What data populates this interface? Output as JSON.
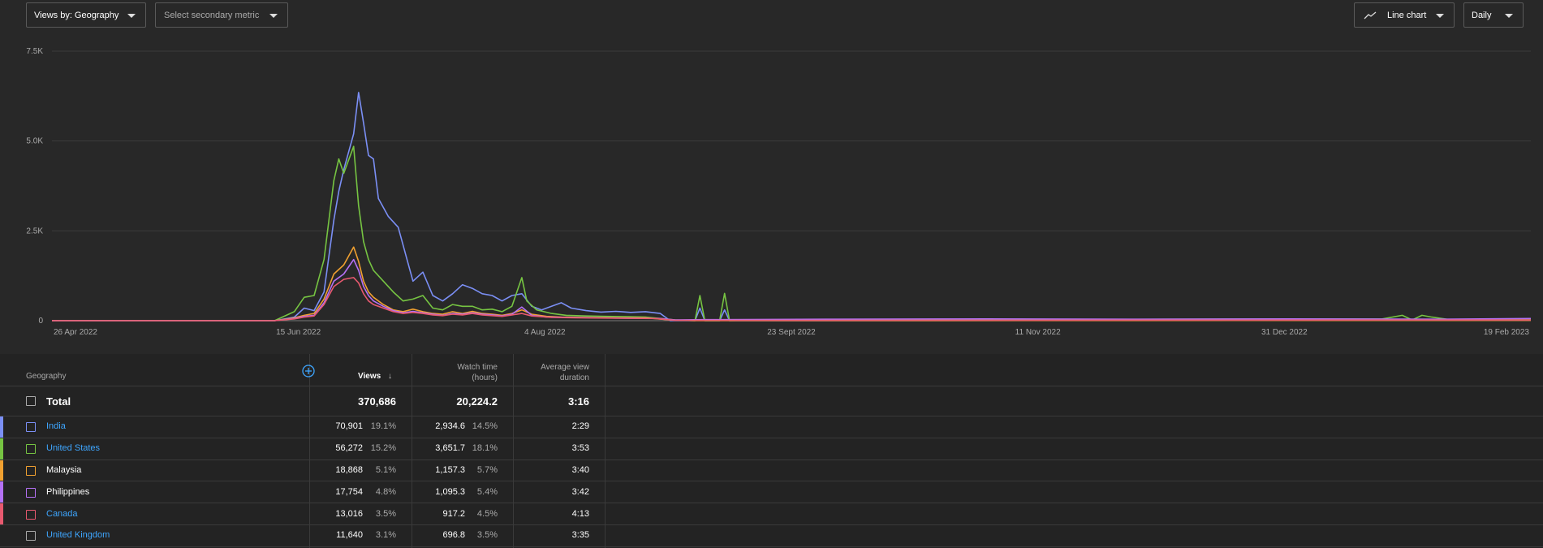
{
  "toolbar": {
    "primary_metric": "Views by: Geography",
    "secondary_metric_placeholder": "Select secondary metric",
    "chart_type": "Line chart",
    "granularity": "Daily"
  },
  "chart_data": {
    "type": "line",
    "xlabels": [
      "26 Apr 2022",
      "15 Jun 2022",
      "4 Aug 2022",
      "23 Sept 2022",
      "11 Nov 2022",
      "31 Dec 2022",
      "19 Feb 2023"
    ],
    "yticks": [
      "0",
      "2.5K",
      "5.0K",
      "7.5K"
    ],
    "ylim": [
      0,
      7500
    ],
    "x_start": "2022-04-26",
    "x_end": "2023-02-19",
    "grid": true,
    "series": [
      {
        "name": "India",
        "color": "#7b8ff5",
        "points": [
          [
            "2022-04-26",
            0
          ],
          [
            "2022-06-10",
            0
          ],
          [
            "2022-06-14",
            100
          ],
          [
            "2022-06-16",
            350
          ],
          [
            "2022-06-18",
            280
          ],
          [
            "2022-06-20",
            800
          ],
          [
            "2022-06-22",
            2800
          ],
          [
            "2022-06-23",
            3600
          ],
          [
            "2022-06-24",
            4200
          ],
          [
            "2022-06-26",
            5200
          ],
          [
            "2022-06-27",
            6350
          ],
          [
            "2022-06-28",
            5500
          ],
          [
            "2022-06-29",
            4600
          ],
          [
            "2022-06-30",
            4500
          ],
          [
            "2022-07-01",
            3400
          ],
          [
            "2022-07-03",
            2900
          ],
          [
            "2022-07-05",
            2600
          ],
          [
            "2022-07-07",
            1600
          ],
          [
            "2022-07-08",
            1100
          ],
          [
            "2022-07-10",
            1350
          ],
          [
            "2022-07-12",
            700
          ],
          [
            "2022-07-14",
            550
          ],
          [
            "2022-07-16",
            750
          ],
          [
            "2022-07-18",
            1000
          ],
          [
            "2022-07-20",
            900
          ],
          [
            "2022-07-22",
            750
          ],
          [
            "2022-07-24",
            700
          ],
          [
            "2022-07-26",
            550
          ],
          [
            "2022-07-28",
            700
          ],
          [
            "2022-07-30",
            750
          ],
          [
            "2022-08-01",
            400
          ],
          [
            "2022-08-03",
            300
          ],
          [
            "2022-08-05",
            400
          ],
          [
            "2022-08-07",
            500
          ],
          [
            "2022-08-09",
            350
          ],
          [
            "2022-08-12",
            280
          ],
          [
            "2022-08-15",
            240
          ],
          [
            "2022-08-18",
            260
          ],
          [
            "2022-08-21",
            230
          ],
          [
            "2022-08-24",
            250
          ],
          [
            "2022-08-27",
            200
          ],
          [
            "2022-08-29",
            0
          ],
          [
            "2022-09-03",
            0
          ],
          [
            "2022-09-04",
            350
          ],
          [
            "2022-09-05",
            0
          ],
          [
            "2022-09-08",
            0
          ],
          [
            "2022-09-09",
            300
          ],
          [
            "2022-09-10",
            0
          ],
          [
            "2022-09-15",
            0
          ],
          [
            "2023-02-19",
            20
          ]
        ]
      },
      {
        "name": "United States",
        "color": "#76c442",
        "points": [
          [
            "2022-04-26",
            0
          ],
          [
            "2022-06-10",
            0
          ],
          [
            "2022-06-14",
            250
          ],
          [
            "2022-06-16",
            650
          ],
          [
            "2022-06-18",
            700
          ],
          [
            "2022-06-20",
            1700
          ],
          [
            "2022-06-22",
            3900
          ],
          [
            "2022-06-23",
            4500
          ],
          [
            "2022-06-24",
            4100
          ],
          [
            "2022-06-26",
            4850
          ],
          [
            "2022-06-27",
            3200
          ],
          [
            "2022-06-28",
            2200
          ],
          [
            "2022-06-29",
            1700
          ],
          [
            "2022-06-30",
            1400
          ],
          [
            "2022-07-02",
            1100
          ],
          [
            "2022-07-04",
            800
          ],
          [
            "2022-07-06",
            550
          ],
          [
            "2022-07-08",
            600
          ],
          [
            "2022-07-10",
            700
          ],
          [
            "2022-07-12",
            350
          ],
          [
            "2022-07-14",
            300
          ],
          [
            "2022-07-16",
            450
          ],
          [
            "2022-07-18",
            400
          ],
          [
            "2022-07-20",
            400
          ],
          [
            "2022-07-22",
            300
          ],
          [
            "2022-07-24",
            320
          ],
          [
            "2022-07-26",
            250
          ],
          [
            "2022-07-28",
            400
          ],
          [
            "2022-07-30",
            1200
          ],
          [
            "2022-07-31",
            550
          ],
          [
            "2022-08-02",
            300
          ],
          [
            "2022-08-05",
            200
          ],
          [
            "2022-08-08",
            150
          ],
          [
            "2022-08-12",
            130
          ],
          [
            "2022-08-16",
            120
          ],
          [
            "2022-08-20",
            110
          ],
          [
            "2022-08-24",
            100
          ],
          [
            "2022-08-27",
            60
          ],
          [
            "2022-08-30",
            20
          ],
          [
            "2022-09-03",
            0
          ],
          [
            "2022-09-04",
            700
          ],
          [
            "2022-09-05",
            0
          ],
          [
            "2022-09-08",
            0
          ],
          [
            "2022-09-09",
            760
          ],
          [
            "2022-09-10",
            0
          ],
          [
            "2022-09-15",
            20
          ],
          [
            "2023-01-20",
            50
          ],
          [
            "2023-01-24",
            150
          ],
          [
            "2023-01-26",
            20
          ],
          [
            "2023-01-28",
            150
          ],
          [
            "2023-01-30",
            100
          ],
          [
            "2023-02-02",
            40
          ],
          [
            "2023-02-19",
            30
          ]
        ]
      },
      {
        "name": "Malaysia",
        "color": "#f0a030",
        "points": [
          [
            "2022-04-26",
            0
          ],
          [
            "2022-06-10",
            0
          ],
          [
            "2022-06-14",
            80
          ],
          [
            "2022-06-16",
            150
          ],
          [
            "2022-06-18",
            200
          ],
          [
            "2022-06-20",
            600
          ],
          [
            "2022-06-22",
            1300
          ],
          [
            "2022-06-24",
            1550
          ],
          [
            "2022-06-26",
            2050
          ],
          [
            "2022-06-27",
            1650
          ],
          [
            "2022-06-28",
            1100
          ],
          [
            "2022-06-29",
            800
          ],
          [
            "2022-06-30",
            650
          ],
          [
            "2022-07-02",
            450
          ],
          [
            "2022-07-04",
            300
          ],
          [
            "2022-07-06",
            250
          ],
          [
            "2022-07-08",
            320
          ],
          [
            "2022-07-10",
            250
          ],
          [
            "2022-07-12",
            200
          ],
          [
            "2022-07-14",
            180
          ],
          [
            "2022-07-16",
            250
          ],
          [
            "2022-07-18",
            200
          ],
          [
            "2022-07-20",
            260
          ],
          [
            "2022-07-22",
            200
          ],
          [
            "2022-07-24",
            180
          ],
          [
            "2022-07-26",
            150
          ],
          [
            "2022-07-28",
            200
          ],
          [
            "2022-07-30",
            300
          ],
          [
            "2022-08-01",
            180
          ],
          [
            "2022-08-04",
            120
          ],
          [
            "2022-08-07",
            100
          ],
          [
            "2022-08-12",
            90
          ],
          [
            "2022-08-18",
            80
          ],
          [
            "2022-08-24",
            80
          ],
          [
            "2022-08-29",
            20
          ],
          [
            "2022-09-03",
            0
          ],
          [
            "2023-02-19",
            10
          ]
        ]
      },
      {
        "name": "Philippines",
        "color": "#b471f5",
        "points": [
          [
            "2022-04-26",
            0
          ],
          [
            "2022-06-10",
            0
          ],
          [
            "2022-06-14",
            60
          ],
          [
            "2022-06-16",
            120
          ],
          [
            "2022-06-18",
            150
          ],
          [
            "2022-06-20",
            500
          ],
          [
            "2022-06-22",
            1100
          ],
          [
            "2022-06-24",
            1300
          ],
          [
            "2022-06-26",
            1700
          ],
          [
            "2022-06-27",
            1400
          ],
          [
            "2022-06-28",
            950
          ],
          [
            "2022-06-29",
            700
          ],
          [
            "2022-06-30",
            550
          ],
          [
            "2022-07-02",
            400
          ],
          [
            "2022-07-04",
            280
          ],
          [
            "2022-07-06",
            220
          ],
          [
            "2022-07-08",
            260
          ],
          [
            "2022-07-10",
            220
          ],
          [
            "2022-07-12",
            180
          ],
          [
            "2022-07-14",
            150
          ],
          [
            "2022-07-16",
            200
          ],
          [
            "2022-07-18",
            180
          ],
          [
            "2022-07-20",
            220
          ],
          [
            "2022-07-22",
            180
          ],
          [
            "2022-07-24",
            160
          ],
          [
            "2022-07-26",
            130
          ],
          [
            "2022-07-28",
            180
          ],
          [
            "2022-07-30",
            380
          ],
          [
            "2022-08-01",
            150
          ],
          [
            "2022-08-04",
            100
          ],
          [
            "2022-08-08",
            90
          ],
          [
            "2022-08-14",
            80
          ],
          [
            "2022-08-20",
            70
          ],
          [
            "2022-08-27",
            60
          ],
          [
            "2022-08-30",
            20
          ],
          [
            "2022-09-05",
            30
          ],
          [
            "2022-10-01",
            40
          ],
          [
            "2022-11-01",
            50
          ],
          [
            "2022-12-01",
            40
          ],
          [
            "2023-01-01",
            50
          ],
          [
            "2023-02-01",
            40
          ],
          [
            "2023-02-19",
            60
          ]
        ]
      },
      {
        "name": "Canada",
        "color": "#e8596f",
        "points": [
          [
            "2022-04-26",
            0
          ],
          [
            "2022-06-10",
            0
          ],
          [
            "2022-06-14",
            50
          ],
          [
            "2022-06-16",
            100
          ],
          [
            "2022-06-18",
            130
          ],
          [
            "2022-06-20",
            450
          ],
          [
            "2022-06-22",
            950
          ],
          [
            "2022-06-24",
            1150
          ],
          [
            "2022-06-26",
            1200
          ],
          [
            "2022-06-27",
            1050
          ],
          [
            "2022-06-28",
            750
          ],
          [
            "2022-06-29",
            550
          ],
          [
            "2022-06-30",
            450
          ],
          [
            "2022-07-02",
            350
          ],
          [
            "2022-07-04",
            250
          ],
          [
            "2022-07-06",
            200
          ],
          [
            "2022-07-08",
            230
          ],
          [
            "2022-07-10",
            200
          ],
          [
            "2022-07-12",
            160
          ],
          [
            "2022-07-14",
            140
          ],
          [
            "2022-07-16",
            180
          ],
          [
            "2022-07-18",
            160
          ],
          [
            "2022-07-20",
            200
          ],
          [
            "2022-07-22",
            160
          ],
          [
            "2022-07-24",
            140
          ],
          [
            "2022-07-26",
            120
          ],
          [
            "2022-07-28",
            160
          ],
          [
            "2022-07-30",
            200
          ],
          [
            "2022-08-01",
            130
          ],
          [
            "2022-08-05",
            90
          ],
          [
            "2022-08-10",
            80
          ],
          [
            "2022-08-18",
            70
          ],
          [
            "2022-08-26",
            60
          ],
          [
            "2022-08-30",
            10
          ],
          [
            "2022-09-05",
            10
          ],
          [
            "2023-02-19",
            20
          ]
        ]
      }
    ]
  },
  "table": {
    "headers": {
      "geography": "Geography",
      "views": "Views",
      "watch_time_line1": "Watch time",
      "watch_time_line2": "(hours)",
      "avd_line1": "Average view",
      "avd_line2": "duration"
    },
    "total": {
      "label": "Total",
      "views": "370,686",
      "watch_time": "20,224.2",
      "avd": "3:16"
    },
    "rows": [
      {
        "name": "India",
        "link": true,
        "color": "#7b8ff5",
        "views": "70,901",
        "views_pct": "19.1%",
        "watch": "2,934.6",
        "watch_pct": "14.5%",
        "avd": "2:29"
      },
      {
        "name": "United States",
        "link": true,
        "color": "#76c442",
        "views": "56,272",
        "views_pct": "15.2%",
        "watch": "3,651.7",
        "watch_pct": "18.1%",
        "avd": "3:53"
      },
      {
        "name": "Malaysia",
        "link": false,
        "color": "#f0a030",
        "views": "18,868",
        "views_pct": "5.1%",
        "watch": "1,157.3",
        "watch_pct": "5.7%",
        "avd": "3:40"
      },
      {
        "name": "Philippines",
        "link": false,
        "color": "#b471f5",
        "views": "17,754",
        "views_pct": "4.8%",
        "watch": "1,095.3",
        "watch_pct": "5.4%",
        "avd": "3:42"
      },
      {
        "name": "Canada",
        "link": true,
        "color": "#e8596f",
        "views": "13,016",
        "views_pct": "3.5%",
        "watch": "917.2",
        "watch_pct": "4.5%",
        "avd": "4:13"
      },
      {
        "name": "United Kingdom",
        "link": true,
        "color": "",
        "views": "11,640",
        "views_pct": "3.1%",
        "watch": "696.8",
        "watch_pct": "3.5%",
        "avd": "3:35"
      }
    ]
  }
}
